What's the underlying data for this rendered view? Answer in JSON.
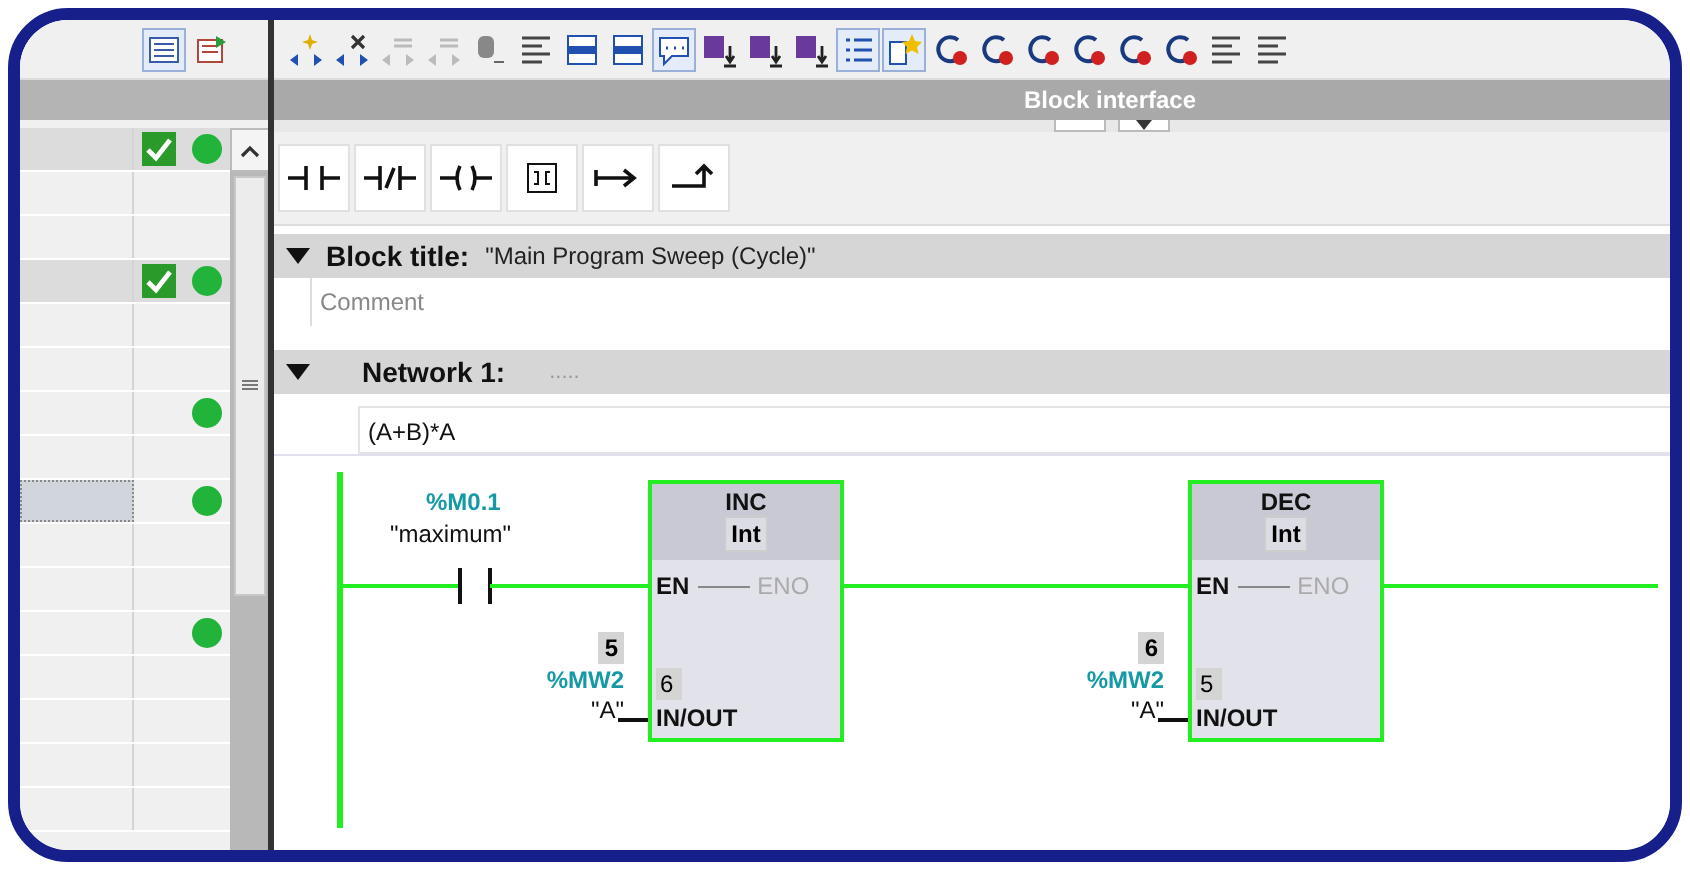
{
  "left_panel": {
    "rows": [
      {
        "checked": true,
        "status_ok": true,
        "highlighted": true,
        "selected": false
      },
      {
        "checked": false,
        "status_ok": false,
        "highlighted": false,
        "selected": false
      },
      {
        "checked": false,
        "status_ok": false,
        "highlighted": false,
        "selected": false
      },
      {
        "checked": true,
        "status_ok": true,
        "highlighted": true,
        "selected": false
      },
      {
        "checked": false,
        "status_ok": false,
        "highlighted": false,
        "selected": false
      },
      {
        "checked": false,
        "status_ok": false,
        "highlighted": false,
        "selected": false
      },
      {
        "checked": false,
        "status_ok": true,
        "highlighted": false,
        "selected": false
      },
      {
        "checked": false,
        "status_ok": false,
        "highlighted": false,
        "selected": false
      },
      {
        "checked": false,
        "status_ok": true,
        "highlighted": false,
        "selected": true
      },
      {
        "checked": false,
        "status_ok": false,
        "highlighted": false,
        "selected": false
      },
      {
        "checked": false,
        "status_ok": false,
        "highlighted": false,
        "selected": false
      },
      {
        "checked": false,
        "status_ok": true,
        "highlighted": false,
        "selected": false
      },
      {
        "checked": false,
        "status_ok": false,
        "highlighted": false,
        "selected": false
      },
      {
        "checked": false,
        "status_ok": false,
        "highlighted": false,
        "selected": false
      },
      {
        "checked": false,
        "status_ok": false,
        "highlighted": false,
        "selected": false
      },
      {
        "checked": false,
        "status_ok": false,
        "highlighted": false,
        "selected": false
      }
    ]
  },
  "block_interface": {
    "label": "Block interface"
  },
  "block": {
    "title_label": "Block title:",
    "title": "\"Main Program Sweep (Cycle)\"",
    "comment_placeholder": "Comment"
  },
  "network": {
    "label": "Network 1:",
    "title_placeholder": ".....",
    "comment": "(A+B)*A",
    "contact": {
      "address": "%M0.1",
      "symbol": "\"maximum\""
    },
    "boxes": [
      {
        "instruction": "INC",
        "type": "Int",
        "en": "EN",
        "eno": "ENO",
        "input_value": "5",
        "address": "%MW2",
        "operand": "\"A\"",
        "output_value": "6",
        "pin": "IN/OUT"
      },
      {
        "instruction": "DEC",
        "type": "Int",
        "en": "EN",
        "eno": "ENO",
        "input_value": "6",
        "address": "%MW2",
        "operand": "\"A\"",
        "output_value": "5",
        "pin": "IN/OUT"
      }
    ]
  }
}
